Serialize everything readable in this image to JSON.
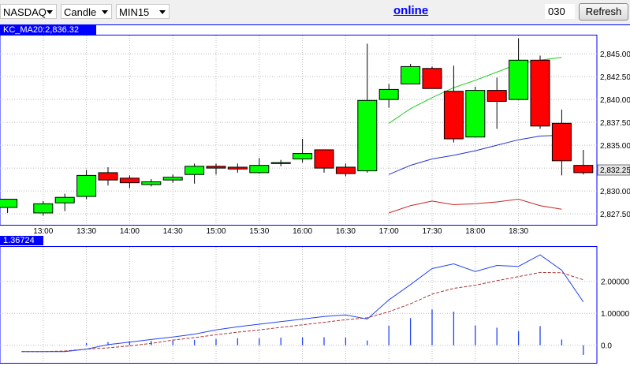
{
  "toolbar": {
    "symbol": "NASDAQ",
    "chart_type": "Candle",
    "interval": "MIN15",
    "status": "online",
    "count": "030",
    "refresh_label": "Refresh"
  },
  "panels": {
    "main_label": "KC_MA20:2,836.32",
    "lower_label": "1.36724",
    "current_price_label": "2,832.25"
  },
  "colors": {
    "up": "#00ff00",
    "down": "#ff0000",
    "upper_band": "#22cc22",
    "middle_band": "#2233cc",
    "lower_band": "#cc2222",
    "indicator_line": "#2244ee",
    "indicator_signal": "#aa3333",
    "panel_border": "#0000ff"
  },
  "chart_data": [
    {
      "type": "candlestick",
      "x_ticks": [
        "13:00",
        "13:30",
        "14:00",
        "14:30",
        "15:00",
        "15:30",
        "16:00",
        "16:30",
        "17:00",
        "17:30",
        "18:00",
        "18:30"
      ],
      "y_ticks": [
        "2,827.50",
        "2,830.00",
        "2,832.50",
        "2,835.00",
        "2,837.50",
        "2,840.00",
        "2,842.50",
        "2,845.00"
      ],
      "ylim": [
        2826.3,
        2847.0
      ],
      "grid": true,
      "candles": [
        {
          "open": 2828.2,
          "high": 2828.8,
          "low": 2827.6,
          "close": 2829.1,
          "partial": true
        },
        {
          "open": 2827.6,
          "high": 2828.9,
          "low": 2827.3,
          "close": 2828.6
        },
        {
          "open": 2828.7,
          "high": 2829.7,
          "low": 2827.8,
          "close": 2829.3
        },
        {
          "open": 2829.4,
          "high": 2832.3,
          "low": 2829.1,
          "close": 2831.7
        },
        {
          "open": 2832.0,
          "high": 2832.6,
          "low": 2830.6,
          "close": 2831.2
        },
        {
          "open": 2831.4,
          "high": 2831.7,
          "low": 2830.3,
          "close": 2830.9
        },
        {
          "open": 2830.7,
          "high": 2831.3,
          "low": 2830.5,
          "close": 2831.0
        },
        {
          "open": 2831.2,
          "high": 2831.8,
          "low": 2830.9,
          "close": 2831.5
        },
        {
          "open": 2831.8,
          "high": 2833.0,
          "low": 2830.8,
          "close": 2832.7
        },
        {
          "open": 2832.7,
          "high": 2833.0,
          "low": 2831.8,
          "close": 2832.5
        },
        {
          "open": 2832.6,
          "high": 2833.0,
          "low": 2832.0,
          "close": 2832.4
        },
        {
          "open": 2832.0,
          "high": 2833.6,
          "low": 2831.9,
          "close": 2832.8
        },
        {
          "open": 2833.0,
          "high": 2833.4,
          "low": 2832.7,
          "close": 2833.1
        },
        {
          "open": 2833.5,
          "high": 2835.7,
          "low": 2833.1,
          "close": 2834.1
        },
        {
          "open": 2834.5,
          "high": 2834.5,
          "low": 2832.0,
          "close": 2832.5
        },
        {
          "open": 2832.6,
          "high": 2833.0,
          "low": 2831.6,
          "close": 2831.9
        },
        {
          "open": 2832.2,
          "high": 2846.1,
          "low": 2832.0,
          "close": 2839.9
        },
        {
          "open": 2840.0,
          "high": 2841.7,
          "low": 2839.1,
          "close": 2841.1
        },
        {
          "open": 2841.7,
          "high": 2843.9,
          "low": 2841.7,
          "close": 2843.6
        },
        {
          "open": 2843.4,
          "high": 2843.6,
          "low": 2841.2,
          "close": 2841.2
        },
        {
          "open": 2840.9,
          "high": 2843.7,
          "low": 2835.3,
          "close": 2835.7
        },
        {
          "open": 2835.9,
          "high": 2841.4,
          "low": 2835.9,
          "close": 2841.0
        },
        {
          "open": 2841.0,
          "high": 2842.4,
          "low": 2836.8,
          "close": 2839.8
        },
        {
          "open": 2840.0,
          "high": 2846.7,
          "low": 2839.9,
          "close": 2844.3
        },
        {
          "open": 2844.3,
          "high": 2844.8,
          "low": 2836.8,
          "close": 2837.1
        },
        {
          "open": 2837.4,
          "high": 2838.9,
          "low": 2831.7,
          "close": 2833.3
        },
        {
          "open": 2832.8,
          "high": 2834.5,
          "low": 2831.8,
          "close": 2832.0
        }
      ],
      "bands": [
        {
          "name": "upper",
          "values": [
            null,
            null,
            null,
            null,
            null,
            null,
            null,
            null,
            null,
            null,
            null,
            null,
            null,
            null,
            null,
            null,
            null,
            2837.4,
            2839.0,
            2840.2,
            2841.3,
            2842.1,
            2843.0,
            2843.9,
            2844.3,
            2844.6,
            null
          ]
        },
        {
          "name": "middle",
          "values": [
            null,
            null,
            null,
            null,
            null,
            null,
            null,
            null,
            null,
            null,
            null,
            null,
            null,
            null,
            null,
            null,
            null,
            2831.8,
            2832.8,
            2833.5,
            2833.9,
            2834.4,
            2835.0,
            2835.6,
            2836.0,
            2836.1,
            null
          ]
        },
        {
          "name": "lower",
          "values": [
            null,
            null,
            null,
            null,
            null,
            null,
            null,
            null,
            null,
            null,
            null,
            null,
            null,
            null,
            null,
            null,
            null,
            2827.6,
            2828.4,
            2828.9,
            2828.5,
            2828.6,
            2828.8,
            2829.1,
            2828.4,
            2828.0,
            null
          ]
        }
      ]
    },
    {
      "type": "line",
      "y_ticks": [
        "0.0",
        "1.00000",
        "2.00000"
      ],
      "ylim": [
        -0.55,
        3.08
      ],
      "grid": true,
      "series": [
        {
          "name": "line",
          "values": [
            -0.2,
            -0.2,
            -0.2,
            -0.12,
            0.02,
            0.1,
            0.18,
            0.26,
            0.35,
            0.48,
            0.58,
            0.66,
            0.74,
            0.82,
            0.9,
            0.95,
            0.82,
            1.42,
            1.9,
            2.4,
            2.55,
            2.31,
            2.5,
            2.47,
            2.83,
            2.35,
            1.36
          ]
        },
        {
          "name": "signal",
          "values": [
            -0.2,
            -0.2,
            -0.18,
            -0.12,
            -0.08,
            -0.02,
            0.06,
            0.16,
            0.24,
            0.33,
            0.41,
            0.48,
            0.56,
            0.64,
            0.72,
            0.8,
            0.86,
            1.05,
            1.3,
            1.6,
            1.78,
            1.88,
            2.02,
            2.15,
            2.28,
            2.27,
            2.05
          ]
        }
      ],
      "histogram": [
        0,
        0,
        0,
        0.07,
        0.1,
        0.13,
        0.14,
        0.15,
        0.17,
        0.2,
        0.22,
        0.22,
        0.24,
        0.25,
        0.25,
        0.24,
        0.15,
        0.61,
        0.85,
        1.12,
        1.05,
        0.62,
        0.55,
        0.44,
        0.6,
        0.18,
        -0.3
      ]
    }
  ]
}
